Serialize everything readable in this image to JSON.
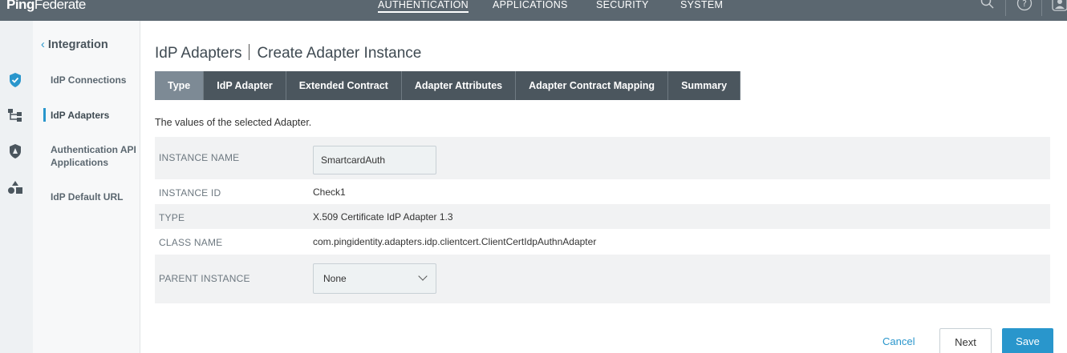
{
  "app": {
    "brand_bold": "Ping",
    "brand_thin": "Federate"
  },
  "top_nav": {
    "items": [
      {
        "label": "AUTHENTICATION",
        "active": true
      },
      {
        "label": "APPLICATIONS",
        "active": false
      },
      {
        "label": "SECURITY",
        "active": false
      },
      {
        "label": "SYSTEM",
        "active": false
      }
    ],
    "icons": [
      "search-icon",
      "help-icon",
      "user-icon"
    ]
  },
  "rail": {
    "icons": [
      "shield-check-icon",
      "hierarchy-icon",
      "shield-lock-icon",
      "shapes-icon"
    ]
  },
  "sidebar": {
    "heading": "Integration",
    "items": [
      {
        "label": "IdP Connections",
        "active": false
      },
      {
        "label": "IdP Adapters",
        "active": true
      },
      {
        "label": "Authentication API Applications",
        "active": false
      },
      {
        "label": "IdP Default URL",
        "active": false
      }
    ]
  },
  "page": {
    "title_left": "IdP Adapters",
    "title_right": "Create Adapter Instance",
    "description": "The values of the selected Adapter."
  },
  "tabs": [
    {
      "label": "Type",
      "active": true
    },
    {
      "label": "IdP Adapter",
      "active": false
    },
    {
      "label": "Extended Contract",
      "active": false
    },
    {
      "label": "Adapter Attributes",
      "active": false
    },
    {
      "label": "Adapter Contract Mapping",
      "active": false
    },
    {
      "label": "Summary",
      "active": false
    }
  ],
  "form": {
    "instance_name": {
      "label": "INSTANCE NAME",
      "value": "SmartcardAuth"
    },
    "instance_id": {
      "label": "INSTANCE ID",
      "value": "Check1"
    },
    "type": {
      "label": "TYPE",
      "value": "X.509 Certificate IdP Adapter 1.3"
    },
    "class_name": {
      "label": "CLASS NAME",
      "value": "com.pingidentity.adapters.idp.clientcert.ClientCertIdpAuthnAdapter"
    },
    "parent_instance": {
      "label": "PARENT INSTANCE",
      "value": "None"
    }
  },
  "buttons": {
    "cancel": "Cancel",
    "next": "Next",
    "save": "Save"
  },
  "colors": {
    "accent": "#2996cc",
    "topbar": "#5b6770",
    "tab_dark": "#4b565e",
    "tab_active": "#7d8a95"
  }
}
